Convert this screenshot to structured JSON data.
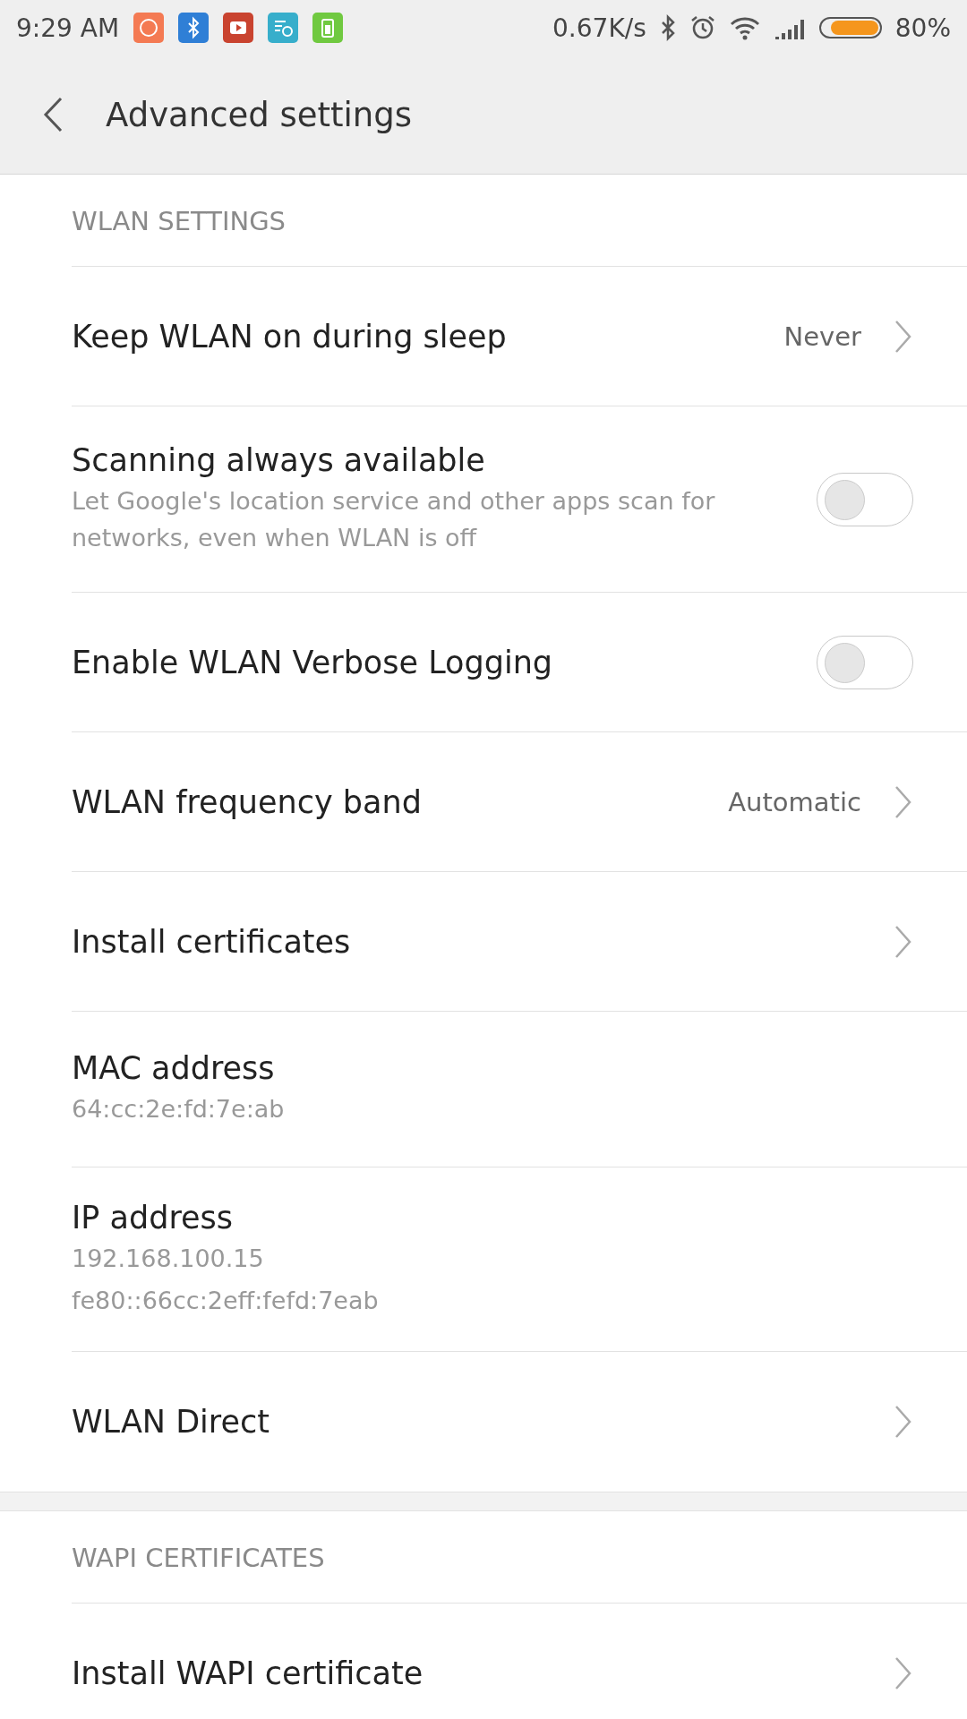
{
  "status_bar": {
    "time": "9:29 AM",
    "speed": "0.67K/s",
    "battery": "80%"
  },
  "header": {
    "title": "Advanced settings"
  },
  "sections": [
    {
      "title": "WLAN SETTINGS",
      "items": [
        {
          "kind": "link",
          "title": "Keep WLAN on during sleep",
          "value": "Never"
        },
        {
          "kind": "toggle",
          "title": "Scanning always available",
          "subtitle": "Let Google's location service and other apps scan for networks, even when WLAN is off",
          "on": false
        },
        {
          "kind": "toggle",
          "title": "Enable WLAN Verbose Logging",
          "on": false
        },
        {
          "kind": "link",
          "title": "WLAN frequency band",
          "value": "Automatic"
        },
        {
          "kind": "link",
          "title": "Install certificates"
        },
        {
          "kind": "info",
          "title": "MAC address",
          "lines": [
            "64:cc:2e:fd:7e:ab"
          ]
        },
        {
          "kind": "info",
          "title": "IP address",
          "lines": [
            "192.168.100.15",
            "fe80::66cc:2eff:fefd:7eab"
          ]
        },
        {
          "kind": "link",
          "title": "WLAN Direct"
        }
      ]
    },
    {
      "title": "WAPI CERTIFICATES",
      "items": [
        {
          "kind": "link",
          "title": "Install WAPI certificate"
        }
      ]
    }
  ]
}
